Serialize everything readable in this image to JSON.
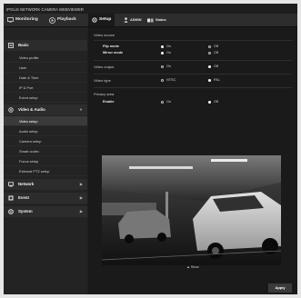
{
  "brand": "IPOLiS NETWORK CAMERA WEBVIEWER",
  "tabs": {
    "monitoring": "Monitoring",
    "playback": "Playback",
    "setup": "Setup",
    "admin": "ADMIN",
    "status": "Status"
  },
  "sidebar": {
    "basic": "Basic",
    "basic_items": [
      "Video profile",
      "User",
      "Date & Time",
      "IP & Port",
      "Event setup"
    ],
    "video_audio": "Video & Audio",
    "video_items": [
      "Video setup",
      "Audio setup",
      "Camera setup",
      "Smart codec",
      "Focus setup",
      "External PTZ setup"
    ],
    "network": "Network",
    "event": "Event",
    "system": "System"
  },
  "main": {
    "video_source": "Video source",
    "flip_mode": "Flip mode",
    "mirror_mode": "Mirror mode",
    "video_output": "Video output",
    "video_type": "Video type",
    "privacy_area": "Privacy area",
    "enable": "Enable",
    "on": "On",
    "off": "Off",
    "ntsc": "NTSC",
    "pal": "PAL",
    "show": "Show",
    "apply": "Apply"
  },
  "state": {
    "flip_mode": "on",
    "mirror_mode": "on",
    "video_output": "off",
    "video_type": "pal",
    "privacy_enable": "off"
  },
  "colors": {
    "background": "#1e1e1e",
    "sidebar": "#232323",
    "selected": "#3a3a3a"
  }
}
